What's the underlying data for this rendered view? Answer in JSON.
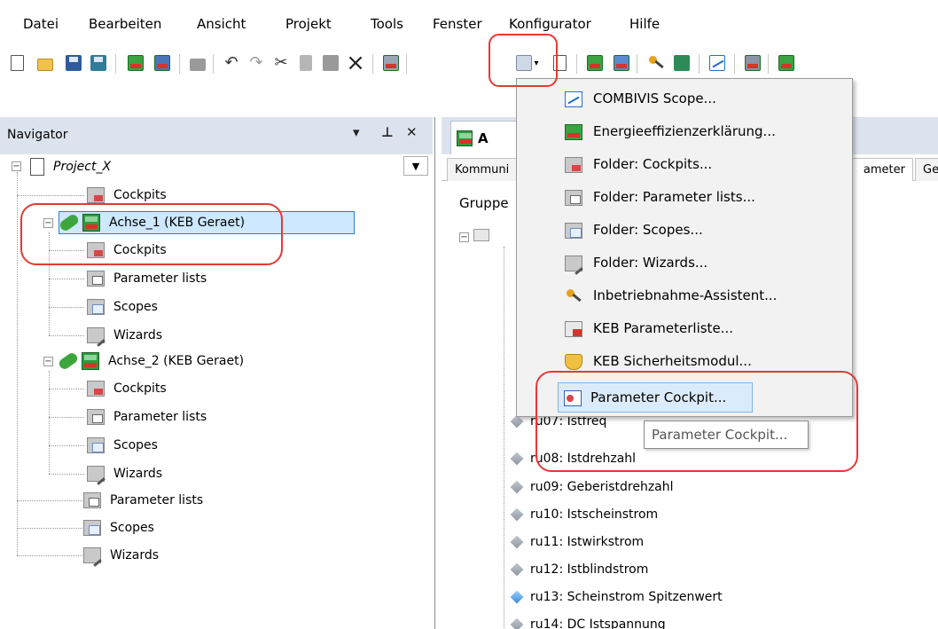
{
  "menubar": {
    "items": [
      "Datei",
      "Bearbeiten",
      "Ansicht",
      "Projekt",
      "Tools",
      "Fenster",
      "Konfigurator",
      "Hilfe"
    ]
  },
  "toolbar": {
    "icons": [
      "new-file-icon",
      "open-folder-icon",
      "save-icon",
      "save-all-icon",
      "keb-device-icon",
      "device-settings-icon",
      "print-icon",
      "undo-icon",
      "redo-icon",
      "cut-icon",
      "copy-icon",
      "paste-icon",
      "delete-icon",
      "keb-parameter-icon",
      "insert-dropdown-icon",
      "export-icon",
      "keb-device-a-icon",
      "keb-device-b-icon",
      "commissioning-key-icon",
      "device-transfer-icon",
      "scope-icon",
      "parameter-list-icon",
      "keb-tool-icon"
    ]
  },
  "navigator": {
    "title": "Navigator",
    "header_buttons": [
      "▾",
      "⊥",
      "✕"
    ],
    "tree": {
      "project": "Project_X",
      "project_cockpits": "Cockpits",
      "axis1": {
        "label": "Achse_1 (KEB Geraet)",
        "children": [
          "Cockpits",
          "Parameter lists",
          "Scopes",
          "Wizards"
        ]
      },
      "axis2": {
        "label": "Achse_2 (KEB Geraet)",
        "children": [
          "Cockpits",
          "Parameter lists",
          "Scopes",
          "Wizards"
        ]
      },
      "project_rest": [
        "Parameter lists",
        "Scopes",
        "Wizards"
      ]
    }
  },
  "right_panel": {
    "doc_tab": "A",
    "sub_tabs": [
      "Kommuni",
      "ameter",
      "Ge"
    ],
    "group_label": "Gruppe",
    "params": [
      {
        "label": "ru07: Istfreq",
        "icon": "gray"
      },
      {
        "label": "ru08: Istdrehzahl",
        "icon": "gray"
      },
      {
        "label": "ru09: Geberistdrehzahl",
        "icon": "gray"
      },
      {
        "label": "ru10: Istscheinstrom",
        "icon": "gray"
      },
      {
        "label": "ru11: Istwirkstrom",
        "icon": "gray"
      },
      {
        "label": "ru12: Istblindstrom",
        "icon": "gray"
      },
      {
        "label": "ru13: Scheinstrom Spitzenwert",
        "icon": "blue"
      },
      {
        "label": "ru14: DC Istspannung",
        "icon": "gray"
      }
    ]
  },
  "dropdown_menu": {
    "items": [
      {
        "label": "COMBIVIS Scope...",
        "icon": "scope-icon"
      },
      {
        "label": "Energieeffizienzerklärung...",
        "icon": "energy-label-icon"
      },
      {
        "label": "Folder: Cockpits...",
        "icon": "folder-cockpits-icon"
      },
      {
        "label": "Folder: Parameter lists...",
        "icon": "folder-parameter-lists-icon"
      },
      {
        "label": "Folder: Scopes...",
        "icon": "folder-scopes-icon"
      },
      {
        "label": "Folder: Wizards...",
        "icon": "folder-wizards-icon"
      },
      {
        "label": "Inbetriebnahme-Assistent...",
        "icon": "key-icon"
      },
      {
        "label": "KEB Parameterliste...",
        "icon": "keb-parameter-list-icon"
      },
      {
        "label": "KEB Sicherheitsmodul...",
        "icon": "safety-module-icon"
      },
      {
        "label": "Parameter Cockpit...",
        "icon": "parameter-cockpit-icon"
      }
    ]
  },
  "tooltip": {
    "text": "Parameter Cockpit..."
  },
  "colors": {
    "panel_header": "#dde3ee",
    "highlight_red": "#e53935",
    "selection_blue": "#cde8ff",
    "menu_hover": "#dcebfb"
  }
}
